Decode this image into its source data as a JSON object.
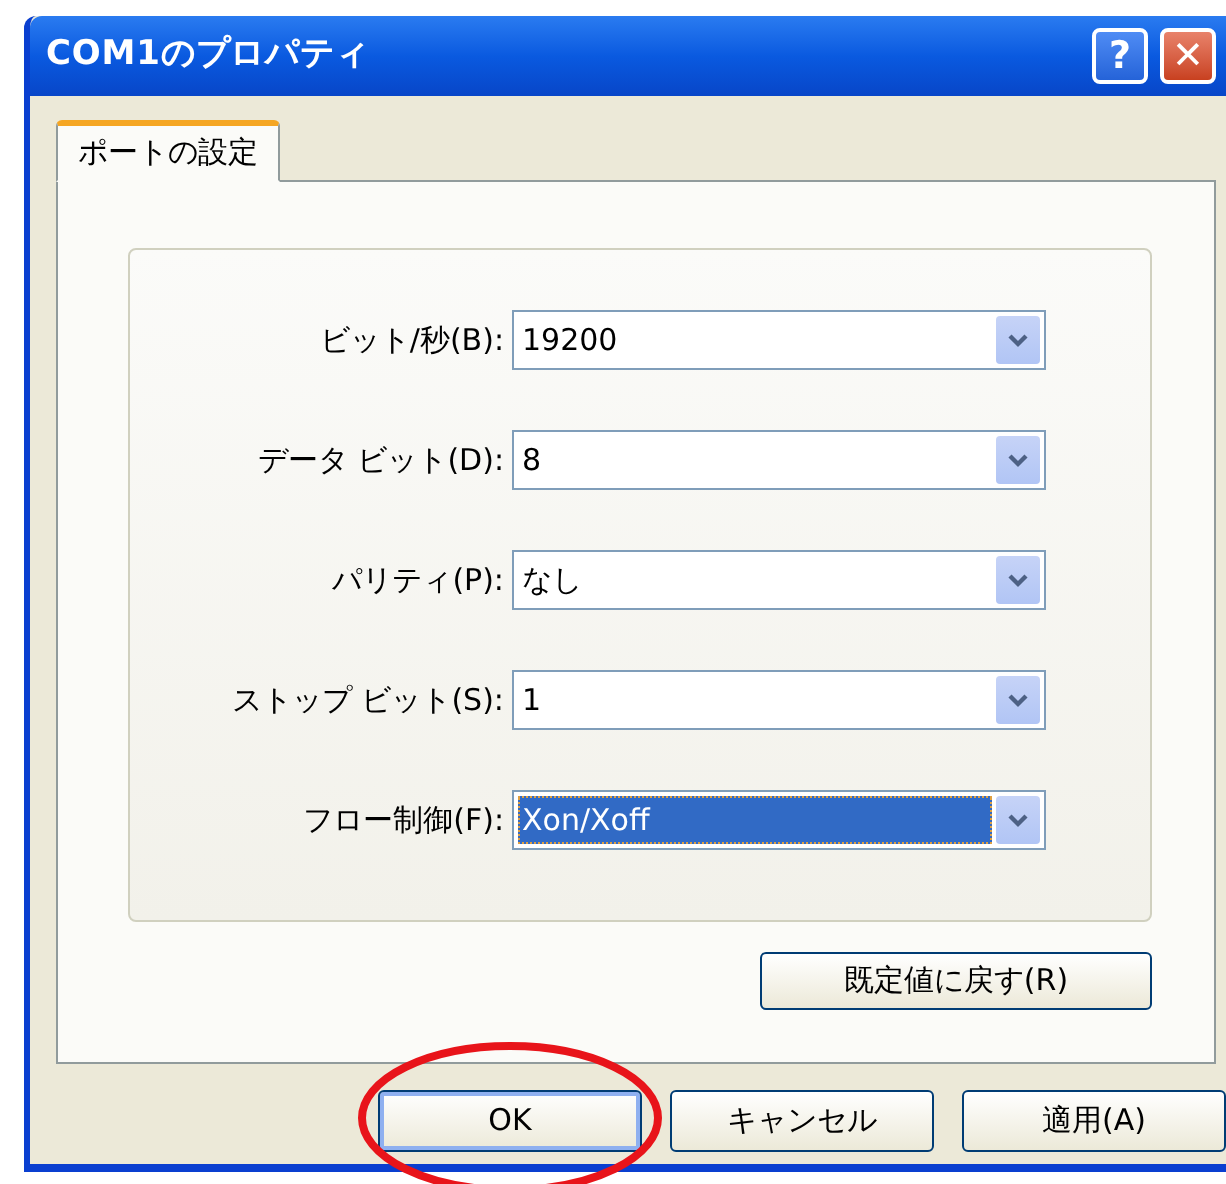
{
  "window": {
    "title": "COM1のプロパティ",
    "title_buttons": [
      {
        "kind": "help",
        "label": "?"
      },
      {
        "kind": "close",
        "label": "✕"
      }
    ]
  },
  "tabs": [
    {
      "label": "ポートの設定",
      "selected": true
    }
  ],
  "fields": [
    {
      "label": "ビット/秒(B):",
      "value": "19200",
      "selected": false
    },
    {
      "label": "データ ビット(D):",
      "value": "8",
      "selected": false
    },
    {
      "label": "パリティ(P):",
      "value": "なし",
      "selected": false
    },
    {
      "label": "ストップ ビット(S):",
      "value": "1",
      "selected": false
    },
    {
      "label": "フロー制御(F):",
      "value": "Xon/Xoff",
      "selected": true
    }
  ],
  "reset_button": "既定値に戻す(R)",
  "buttons": [
    {
      "label": "OK",
      "focused": true,
      "circled": true
    },
    {
      "label": "キャンセル",
      "focused": false,
      "circled": false
    },
    {
      "label": "適用(A)",
      "focused": false,
      "circled": false
    }
  ]
}
